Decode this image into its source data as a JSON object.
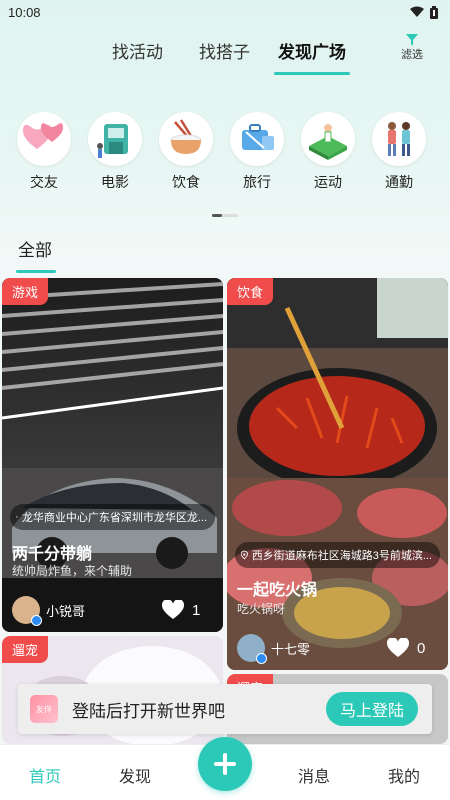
{
  "status_bar": {
    "time": "10:08"
  },
  "top_tabs": [
    {
      "label": "找活动"
    },
    {
      "label": "找搭子"
    },
    {
      "label": "发现广场",
      "active": true
    }
  ],
  "filter": {
    "label": "滤选",
    "icon": "filter-icon"
  },
  "categories": [
    {
      "label": "交友",
      "icon": "hearts-icon"
    },
    {
      "label": "电影",
      "icon": "cinema-icon"
    },
    {
      "label": "饮食",
      "icon": "rice-bowl-icon"
    },
    {
      "label": "旅行",
      "icon": "suitcase-icon"
    },
    {
      "label": "运动",
      "icon": "sports-field-icon"
    },
    {
      "label": "通勤",
      "icon": "commuters-icon"
    }
  ],
  "feed_filter": {
    "label": "全部"
  },
  "posts": [
    {
      "tag": "游戏",
      "location": "龙华商业中心广东省深圳市龙华区龙...",
      "title": "两千分带躺",
      "description": "统帅局炸鱼，来个辅助",
      "user": "小锐哥",
      "likes": "1"
    },
    {
      "tag": "饮食",
      "location": "西乡街道麻布社区海城路3号前城滨...",
      "title": "一起吃火锅",
      "description": "吃火锅呀",
      "user": "十七零",
      "likes": "0"
    },
    {
      "tag": "遛宠"
    },
    {
      "tag": "遛宠"
    }
  ],
  "login_banner": {
    "text": "登陆后打开新世界吧",
    "button": "马上登陆",
    "logo_text": "友伴"
  },
  "bottom_nav": [
    {
      "label": "首页",
      "active": true
    },
    {
      "label": "发现"
    },
    {
      "label": "消息"
    },
    {
      "label": "我的"
    }
  ],
  "colors": {
    "accent": "#2dc9b8",
    "tag": "#f04c4c"
  }
}
